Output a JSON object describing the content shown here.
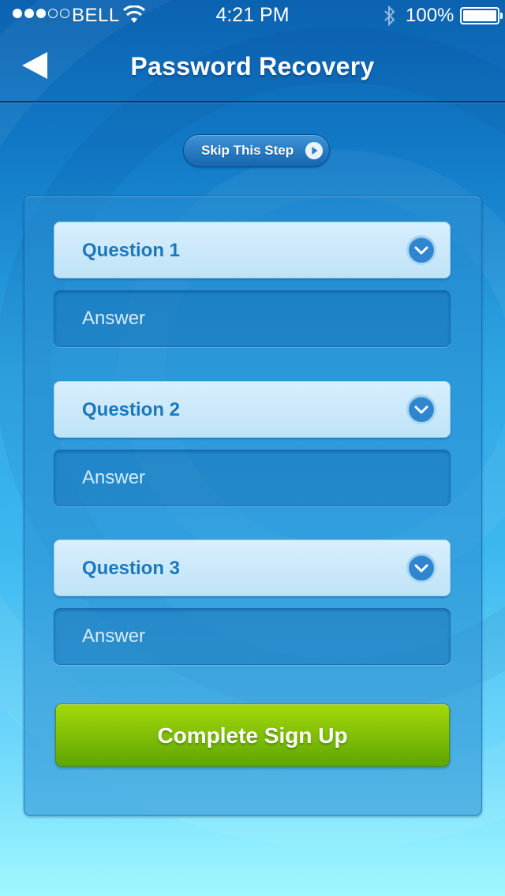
{
  "status_bar": {
    "carrier": "BELL",
    "time": "4:21 PM",
    "battery": "100%",
    "signal_strength_filled": 3,
    "signal_strength_total": 5,
    "battery_level": 1.0
  },
  "nav": {
    "title": "Password Recovery",
    "back_icon": "back-arrow-icon"
  },
  "skip": {
    "label": "Skip This Step",
    "icon": "play-arrow-icon"
  },
  "questions": [
    {
      "label": "Question 1",
      "answer_placeholder": "Answer"
    },
    {
      "label": "Question 2",
      "answer_placeholder": "Answer"
    },
    {
      "label": "Question 3",
      "answer_placeholder": "Answer"
    }
  ],
  "submit": {
    "label": "Complete Sign Up"
  },
  "colors": {
    "nav_bg": "#0b62b0",
    "question_text": "#1c78bd",
    "submit_green": "#7cc005",
    "bottom_bg": "#9ff8ff"
  }
}
